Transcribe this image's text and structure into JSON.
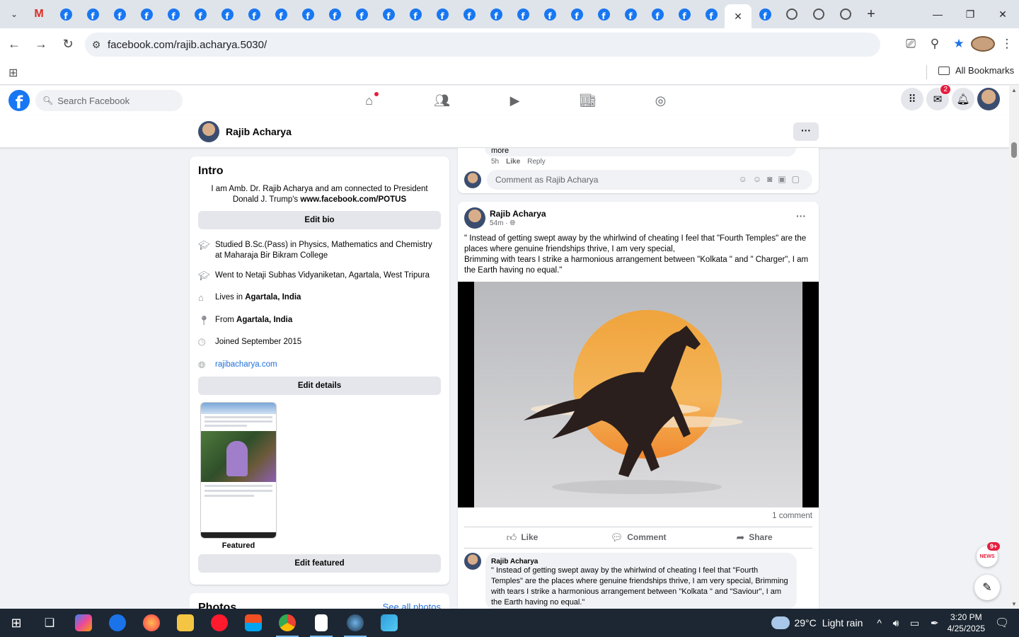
{
  "browser": {
    "tab_count_facebook": 26,
    "url": "facebook.com/rajib.acharya.5030/",
    "all_bookmarks": "All Bookmarks"
  },
  "fb": {
    "search_placeholder": "Search Facebook",
    "messenger_badge": "2"
  },
  "profile": {
    "name": "Rajib Acharya"
  },
  "intro": {
    "title": "Intro",
    "bio_text": "I am Amb. Dr. Rajib Acharya and am connected to President Donald J. Trump's ",
    "bio_link": "www.facebook.com/POTUS",
    "edit_bio": "Edit bio",
    "studied": "Studied B.Sc.(Pass) in Physics, Mathematics and Chemistry at Maharaja Bir Bikram College",
    "went_to": "Went to Netaji Subhas Vidyaniketan, Agartala, West Tripura",
    "lives_prefix": "Lives in ",
    "lives_place": "Agartala, India",
    "from_prefix": "From ",
    "from_place": "Agartala, India",
    "joined": "Joined September 2015",
    "website": "rajibacharya.com",
    "edit_details": "Edit details",
    "featured_label": "Featured",
    "edit_featured": "Edit featured"
  },
  "photos": {
    "title": "Photos",
    "see_all": "See all photos"
  },
  "prev_post": {
    "more": "more",
    "time": "5h",
    "like": "Like",
    "reply": "Reply",
    "comment_placeholder": "Comment as Rajib Acharya"
  },
  "post": {
    "author": "Rajib Acharya",
    "time": "54m",
    "text_line1": "\" Instead of getting swept away by the whirlwind of cheating I feel that \"Fourth Temples\" are the places where genuine friendships thrive, I am very special,",
    "text_line2": "Brimming with tears I strike a harmonious arrangement between \"Kolkata \" and \" Charger\", I am the Earth having no equal.\"",
    "comments_count": "1 comment",
    "like": "Like",
    "comment": "Comment",
    "share": "Share"
  },
  "top_comment": {
    "author": "Rajib Acharya",
    "text": "\" Instead of getting swept away by the whirlwind of cheating I feel that \"Fourth Temples\" are the places where genuine friendships thrive, I am very special, Brimming with tears I strike a harmonious arrangement between \"Kolkata \" and \"Saviour\", I am the Earth having no equal.\""
  },
  "floating": {
    "news_badge": "9+",
    "news_label": "NEWS"
  },
  "taskbar": {
    "temperature": "29°C",
    "condition": "Light rain",
    "time": "3:20 PM",
    "date": "4/25/2025"
  },
  "colors": {
    "facebook_blue": "#1877f2",
    "link_blue": "#216fdb",
    "badge_red": "#e41e3f"
  }
}
